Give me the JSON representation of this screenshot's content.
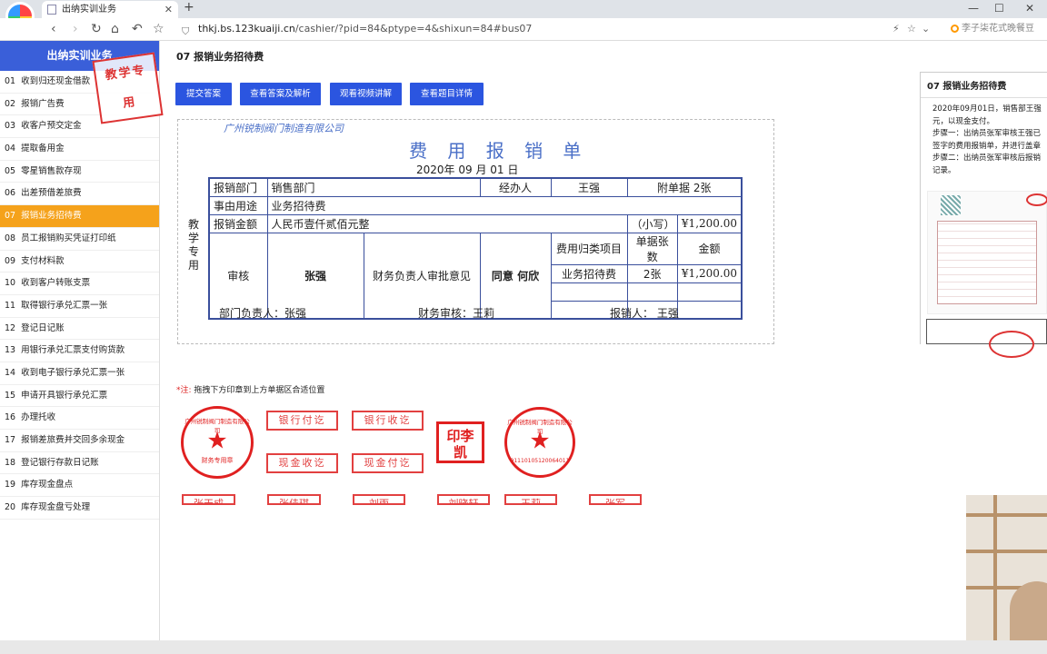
{
  "browser": {
    "tab_title": "出纳实训业务",
    "url_domain": "thkj.bs.123kuaiji.cn",
    "url_path": "/cashier/?pid=84&ptype=4&shixun=84#bus07",
    "search_placeholder": "李子柒花式晚餐豆"
  },
  "sidebar": {
    "header": "出纳实训业务",
    "stamp": "教学专用",
    "items": [
      {
        "num": "01",
        "label": "收到归还现金借款"
      },
      {
        "num": "02",
        "label": "报销广告费"
      },
      {
        "num": "03",
        "label": "收客户预交定金"
      },
      {
        "num": "04",
        "label": "提取备用金"
      },
      {
        "num": "05",
        "label": "零星销售款存现"
      },
      {
        "num": "06",
        "label": "出差预借差旅费"
      },
      {
        "num": "07",
        "label": "报销业务招待费"
      },
      {
        "num": "08",
        "label": "员工报销购买凭证打印纸"
      },
      {
        "num": "09",
        "label": "支付材料款"
      },
      {
        "num": "10",
        "label": "收到客户转账支票"
      },
      {
        "num": "11",
        "label": "取得银行承兑汇票一张"
      },
      {
        "num": "12",
        "label": "登记日记账"
      },
      {
        "num": "13",
        "label": "用银行承兑汇票支付购货款"
      },
      {
        "num": "14",
        "label": "收到电子银行承兑汇票一张"
      },
      {
        "num": "15",
        "label": "申请开具银行承兑汇票"
      },
      {
        "num": "16",
        "label": "办理托收"
      },
      {
        "num": "17",
        "label": "报销差旅费并交回多余现金"
      },
      {
        "num": "18",
        "label": "登记银行存款日记账"
      },
      {
        "num": "19",
        "label": "库存现金盘点"
      },
      {
        "num": "20",
        "label": "库存现金盘亏处理"
      }
    ]
  },
  "main": {
    "title": "07 报销业务招待费",
    "buttons": [
      "提交答案",
      "查看答案及解析",
      "观看视频讲解",
      "查看题目详情"
    ],
    "note_prefix": "*注:",
    "note_text": "拖拽下方印章到上方单据区合适位置"
  },
  "form": {
    "company": "广州锐制阀门制造有限公司",
    "title": "费 用 报 销 单",
    "date": "2020年 09 月 01 日",
    "vertical": "教学专用",
    "dept_label": "报销部门",
    "dept_value": "销售部门",
    "handler_label": "经办人",
    "handler_value": "王强",
    "attach": "附单据 2张",
    "purpose_label": "事由用途",
    "purpose_value": "业务招待费",
    "amount_label": "报销金额",
    "amount_words": "人民币壹仟贰佰元整",
    "small_label": "（小写）",
    "amount_small": "¥1,200.00",
    "audit_label": "审核",
    "audit_value": "张强",
    "finance_label": "财务负责人审批意见",
    "finance_value": "同意 何欣",
    "col_item": "费用归类项目",
    "col_count": "单据张数",
    "col_amount": "金额",
    "row_item": "业务招待费",
    "row_count": "2张",
    "row_amount": "¥1,200.00",
    "sign_dept": "部门负责人：张强",
    "sign_finance": "财务审核：王莉",
    "sign_reporter": "报销人：  王强"
  },
  "stamps": {
    "finance_seal_top": "广州锐制阀门制造有限公司",
    "finance_seal_bottom": "财务专用章",
    "bank_pay": "银行付讫",
    "bank_recv": "银行收讫",
    "cash_recv": "现金收讫",
    "cash_pay": "现金付讫",
    "li_seal": "印李凯",
    "company_seal_top": "广州锐制阀门制造有限公司",
    "company_seal_num": "91110105120064011",
    "names": [
      "张天成",
      "张佳琪",
      "刘雨",
      "刘晓轩",
      "王莉",
      "张军"
    ]
  },
  "right_panel": {
    "title": "07 报销业务招待费",
    "lines": [
      "2020年09月01日，销售部王强",
      "元，以现金支付。",
      "步骤一：出纳员张军审核王强已",
      "签字的费用报销单，并进行盖章",
      "步骤二：出纳员张军审核后报销",
      "记录。"
    ]
  }
}
